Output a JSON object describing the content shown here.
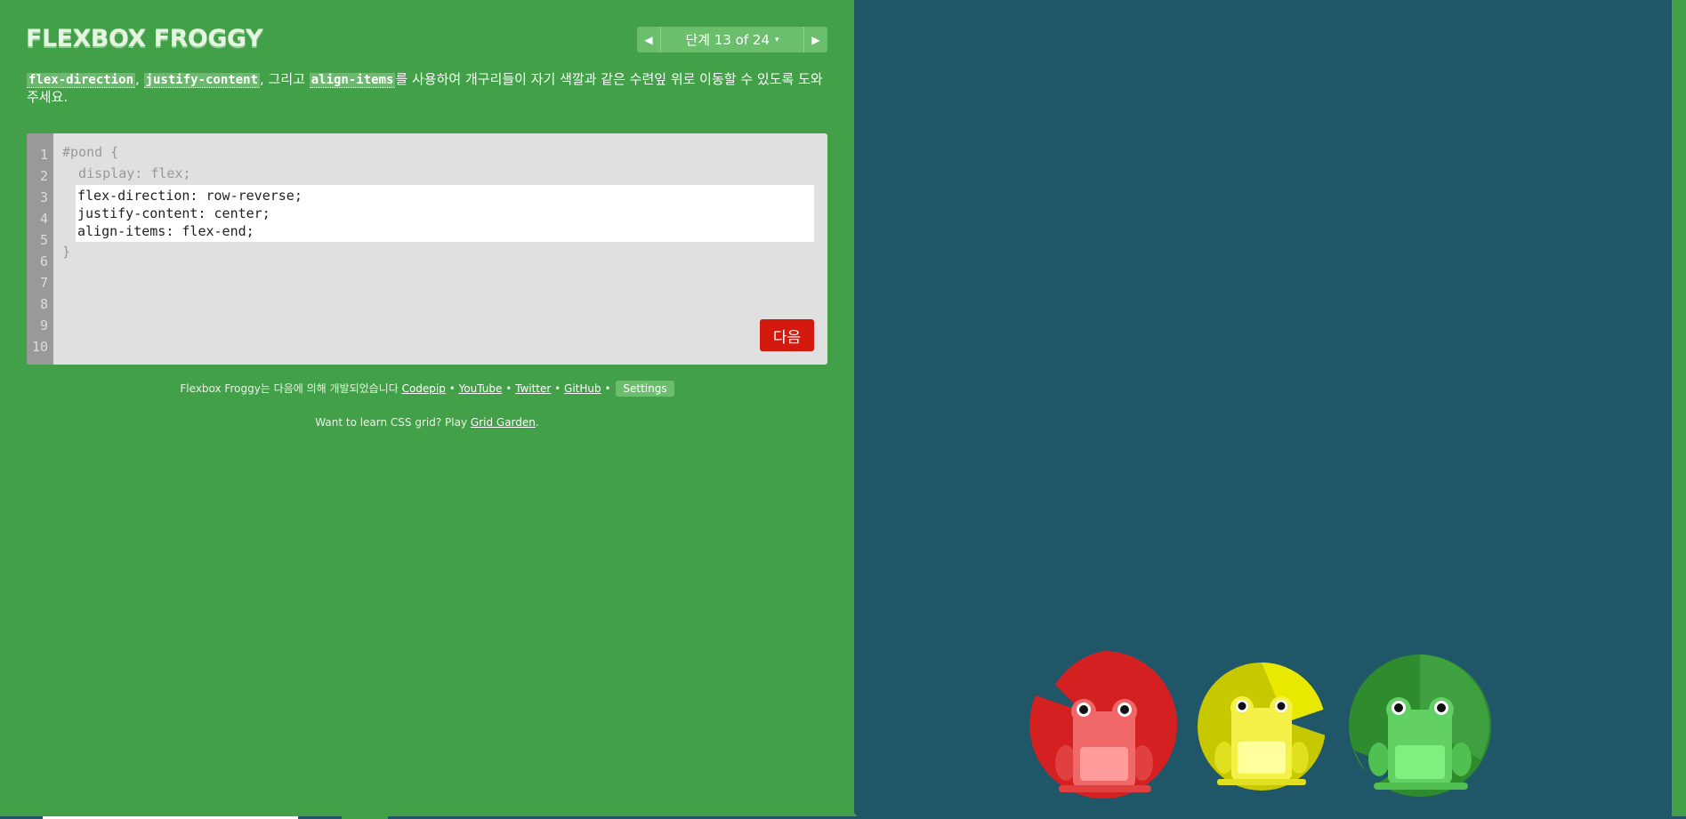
{
  "app": {
    "title": "FLEXBOX FROGGY"
  },
  "level_nav": {
    "prev_icon": "triangle-left-icon",
    "next_icon": "triangle-right-icon",
    "label": "단계 13 of 24",
    "caret": "▾"
  },
  "instructions": {
    "code1": "flex-direction",
    "sep1": ", ",
    "code2": "justify-content",
    "sep2": ", 그리고 ",
    "code3": "align-items",
    "text": "를 사용하여 개구리들이 자기 색깔과 같은 수련잎 위로 이동할 수 있도록 도와주세요."
  },
  "editor": {
    "line_numbers": [
      "1",
      "2",
      "3",
      "4",
      "5",
      "6",
      "7",
      "8",
      "9",
      "10"
    ],
    "line1": "#pond {",
    "line2": "  display: flex;",
    "input_value": "flex-direction: row-reverse;\njustify-content: center;\nalign-items: flex-end;",
    "line6": "}",
    "next_label": "다음"
  },
  "credits": {
    "prefix": "Flexbox Froggy는 다음에 의해 개발되었습니다 ",
    "links": [
      "Codepip",
      "YouTube",
      "Twitter",
      "GitHub"
    ],
    "bullet": " • ",
    "settings_label": "Settings"
  },
  "grid_garden": {
    "prefix": "Want to learn CSS grid? Play ",
    "link": "Grid Garden",
    "suffix": "."
  },
  "pond": {
    "frogs": [
      {
        "color": "red",
        "lily_color": "#d42020",
        "frog_color": "#f06868"
      },
      {
        "color": "yellow",
        "lily_color": "#c8c800",
        "frog_color": "#f5f048"
      },
      {
        "color": "green",
        "lily_color": "#2e8b2e",
        "frog_color": "#62d062"
      }
    ],
    "background": "#1f5768"
  },
  "colors": {
    "sidebar_bg": "#42a048",
    "next_button": "#d4190f",
    "pond_bg": "#1f5768"
  }
}
